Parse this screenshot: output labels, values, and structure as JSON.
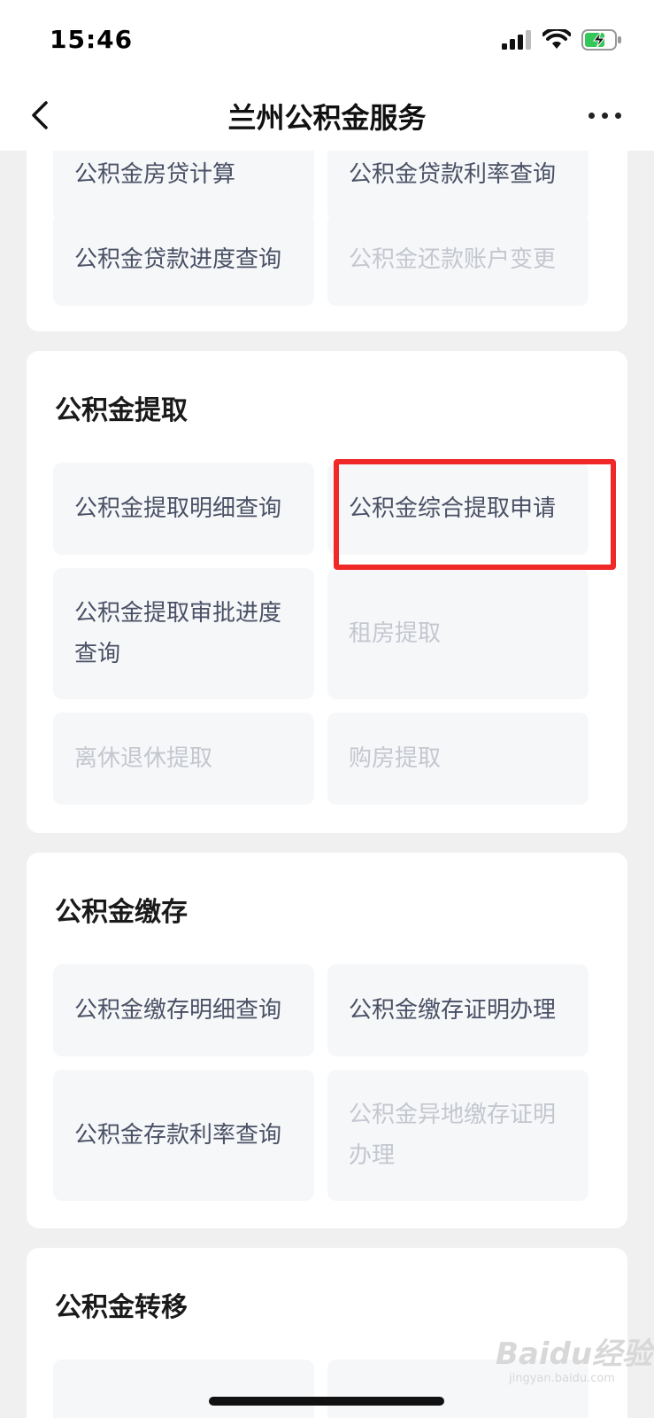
{
  "status": {
    "time": "15:46"
  },
  "nav": {
    "title": "兰州公积金服务"
  },
  "section_loan": {
    "tiles": [
      {
        "label": "公积金房贷计算",
        "disabled": false
      },
      {
        "label": "公积金贷款利率查询",
        "disabled": false
      },
      {
        "label": "公积金贷款进度查询",
        "disabled": false
      },
      {
        "label": "公积金还款账户变更",
        "disabled": true
      }
    ]
  },
  "section_withdraw": {
    "title": "公积金提取",
    "tiles": [
      {
        "label": "公积金提取明细查询",
        "disabled": false
      },
      {
        "label": "公积金综合提取申请",
        "disabled": false
      },
      {
        "label": "公积金提取审批进度查询",
        "disabled": false
      },
      {
        "label": "租房提取",
        "disabled": true
      },
      {
        "label": "离休退休提取",
        "disabled": true
      },
      {
        "label": "购房提取",
        "disabled": true
      }
    ]
  },
  "section_deposit": {
    "title": "公积金缴存",
    "tiles": [
      {
        "label": "公积金缴存明细查询",
        "disabled": false
      },
      {
        "label": "公积金缴存证明办理",
        "disabled": false
      },
      {
        "label": "公积金存款利率查询",
        "disabled": false
      },
      {
        "label": "公积金异地缴存证明办理",
        "disabled": true
      }
    ]
  },
  "section_transfer": {
    "title": "公积金转移"
  },
  "watermark": {
    "logo": "Baidu经验",
    "sub": "jingyan.baidu.com"
  }
}
